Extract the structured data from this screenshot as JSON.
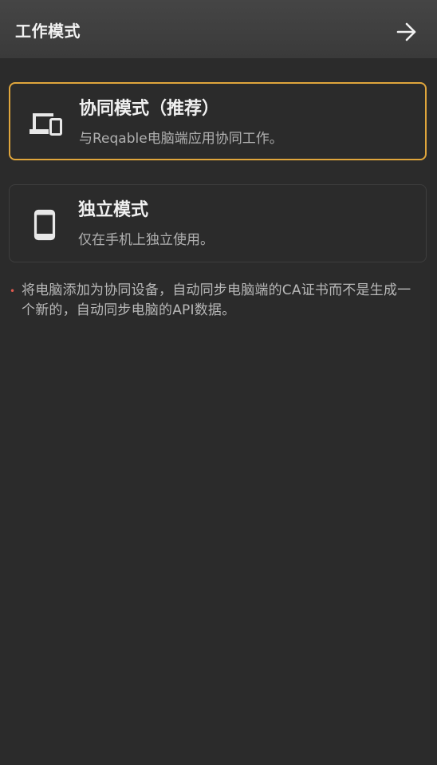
{
  "app_bar": {
    "title": "工作模式",
    "next_icon": "arrow-right-icon"
  },
  "modes": [
    {
      "title": "协同模式（推荐）",
      "subtitle": "与Reqable电脑端应用协同工作。",
      "icon": "devices-icon",
      "selected": true
    },
    {
      "title": "独立模式",
      "subtitle": "仅在手机上独立使用。",
      "icon": "smartphone-icon",
      "selected": false
    }
  ],
  "note": {
    "bullet": "•",
    "text": "将电脑添加为协同设备，自动同步电脑端的CA证书而不是生成一个新的，自动同步电脑的API数据。"
  },
  "colors": {
    "background": "#2b2b2b",
    "app_bar": "#3f3f3f",
    "accent_border": "#e0a63c",
    "card_border": "#3e3e3e",
    "bullet": "#e05a4f"
  }
}
